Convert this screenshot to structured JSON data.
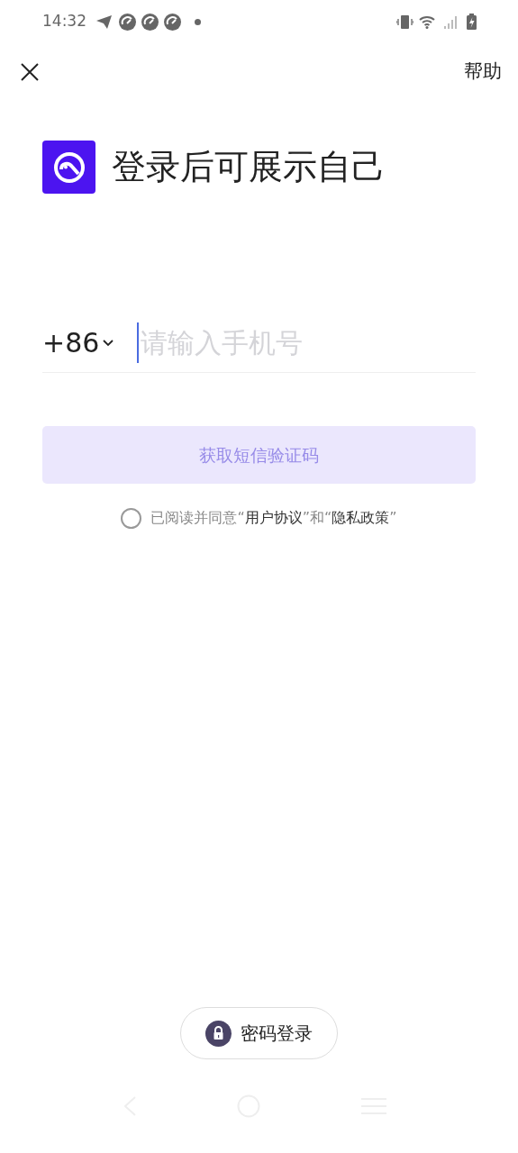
{
  "status_bar": {
    "time": "14:32"
  },
  "top_bar": {
    "help": "帮助"
  },
  "heading": "登录后可展示自己",
  "phone": {
    "country_code": "+86",
    "placeholder": "请输入手机号",
    "focused": true
  },
  "sms_button": {
    "label": "获取短信验证码",
    "disabled": true
  },
  "agreement": {
    "checked": false,
    "parts": [
      {
        "kind": "plain",
        "text": "已阅读并同意“"
      },
      {
        "kind": "link",
        "text": "用户协议"
      },
      {
        "kind": "plain",
        "text": "”和“"
      },
      {
        "kind": "link",
        "text": "隐私政策"
      },
      {
        "kind": "plain",
        "text": "”"
      }
    ]
  },
  "password_login": {
    "label": "密码登录"
  }
}
